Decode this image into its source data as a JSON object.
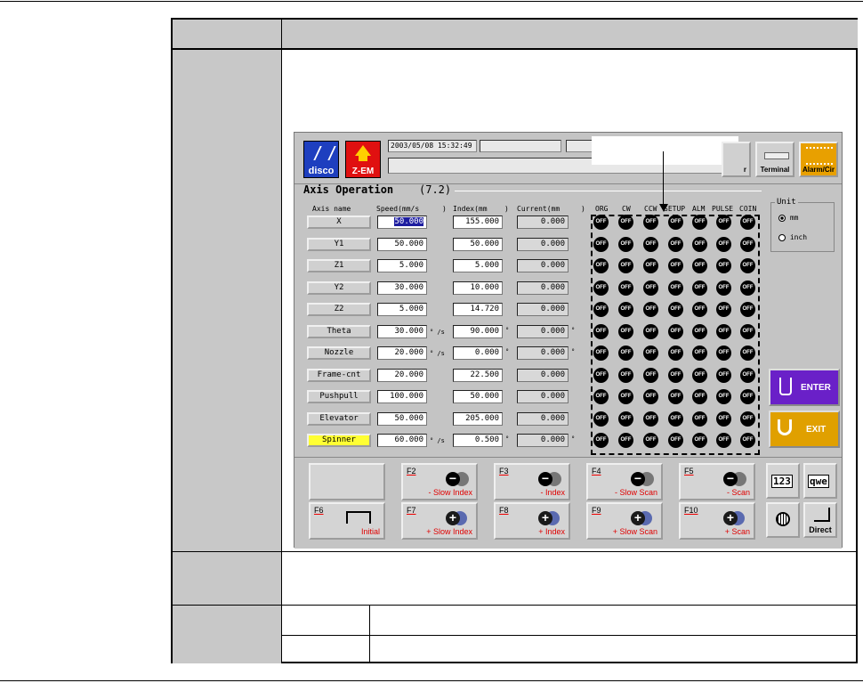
{
  "screen": {
    "datetime": "2003/05/08 15:32:49",
    "logos": {
      "disco": "disco",
      "zem": "Z-EM"
    },
    "top_buttons": {
      "partial": "r",
      "terminal": "Terminal",
      "alarm": "Alarm/Cir"
    },
    "title": "Axis Operation",
    "version": "(7.2)",
    "headers": {
      "axis_name": "Axis name",
      "speed": "Speed(mm/s",
      "paren1": ")",
      "index": "Index(mm",
      "paren2": ")",
      "current": "Current(mm",
      "paren3": ")",
      "org": "ORG",
      "cw": "CW",
      "ccw": "CCW",
      "setup": "SETUP",
      "alm": "ALM",
      "pulse": "PULSE",
      "coin": "COIN"
    },
    "axes": [
      {
        "name": "X",
        "speed": "50.000",
        "index": "155.000",
        "current": "0.000",
        "speed_unit": "",
        "index_unit": "",
        "current_unit": ""
      },
      {
        "name": "Y1",
        "speed": "50.000",
        "index": "50.000",
        "current": "0.000",
        "speed_unit": "",
        "index_unit": "",
        "current_unit": ""
      },
      {
        "name": "Z1",
        "speed": "5.000",
        "index": "5.000",
        "current": "0.000",
        "speed_unit": "",
        "index_unit": "",
        "current_unit": ""
      },
      {
        "name": "Y2",
        "speed": "30.000",
        "index": "10.000",
        "current": "0.000",
        "speed_unit": "",
        "index_unit": "",
        "current_unit": ""
      },
      {
        "name": "Z2",
        "speed": "5.000",
        "index": "14.720",
        "current": "0.000",
        "speed_unit": "",
        "index_unit": "",
        "current_unit": ""
      },
      {
        "name": "Theta",
        "speed": "30.000",
        "index": "90.000",
        "current": "0.000",
        "speed_unit": "° /s",
        "index_unit": "°",
        "current_unit": "°"
      },
      {
        "name": "Nozzle",
        "speed": "20.000",
        "index": "0.000",
        "current": "0.000",
        "speed_unit": "° /s",
        "index_unit": "°",
        "current_unit": "°"
      },
      {
        "name": "Frame-cnt",
        "speed": "20.000",
        "index": "22.500",
        "current": "0.000",
        "speed_unit": "",
        "index_unit": "",
        "current_unit": ""
      },
      {
        "name": "Pushpull",
        "speed": "100.000",
        "index": "50.000",
        "current": "0.000",
        "speed_unit": "",
        "index_unit": "",
        "current_unit": ""
      },
      {
        "name": "Elevator",
        "speed": "50.000",
        "index": "205.000",
        "current": "0.000",
        "speed_unit": "",
        "index_unit": "",
        "current_unit": ""
      },
      {
        "name": "Spinner",
        "speed": "60.000",
        "index": "0.500",
        "current": "0.000",
        "speed_unit": "° /s",
        "index_unit": "°",
        "current_unit": "°"
      }
    ],
    "led_label": "OFF",
    "unit_panel": {
      "title": "Unit",
      "mm": "mm",
      "inch": "inch"
    },
    "enter_label": "ENTER",
    "exit_label": "EXIT",
    "fkeys": [
      {
        "key": "F2",
        "label": "- Slow Index",
        "sign": "−"
      },
      {
        "key": "F3",
        "label": "- Index",
        "sign": "−"
      },
      {
        "key": "F4",
        "label": "- Slow Scan",
        "sign": "−"
      },
      {
        "key": "F5",
        "label": "- Scan",
        "sign": "−"
      },
      {
        "key": "F6",
        "label": "Initial",
        "sign": ""
      },
      {
        "key": "F7",
        "label": "+ Slow Index",
        "sign": "+"
      },
      {
        "key": "F8",
        "label": "+ Index",
        "sign": "+"
      },
      {
        "key": "F9",
        "label": "+ Slow Scan",
        "sign": "+"
      },
      {
        "key": "F10",
        "label": "+ Scan",
        "sign": "+"
      }
    ],
    "side_buttons": {
      "num": "123",
      "qwe": "qwe",
      "direct": "Direct"
    }
  }
}
